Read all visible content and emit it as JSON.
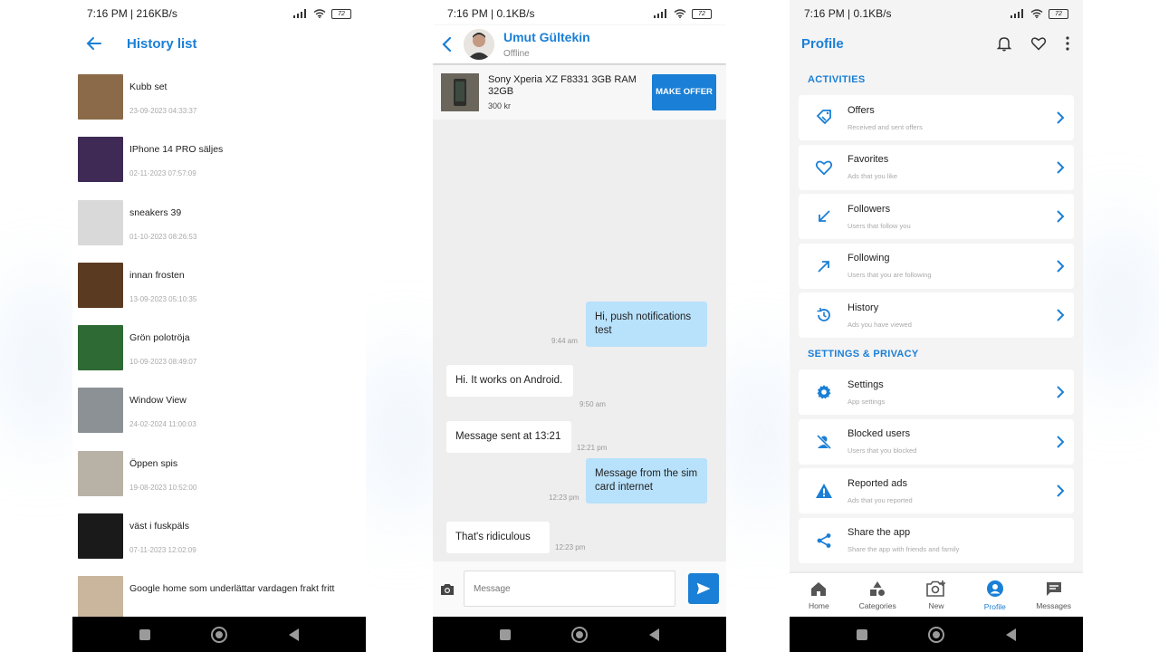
{
  "colors": {
    "accent": "#1a7fd6",
    "bubble_out": "#b8e1fb",
    "bubble_in": "#ffffff"
  },
  "phone1": {
    "status_text": "7:16 PM | 216KB/s",
    "battery": "72",
    "title": "History list",
    "items": [
      {
        "name": "Kubb set",
        "date": "23-09-2023 04:33:37",
        "thumb_color": "#8a6a48"
      },
      {
        "name": "IPhone 14 PRO säljes",
        "date": "02-11-2023 07:57:09",
        "thumb_color": "#3e2a55"
      },
      {
        "name": "sneakers 39",
        "date": "01-10-2023 08:26:53",
        "thumb_color": "#d9d9d9"
      },
      {
        "name": "innan frosten",
        "date": "13-09-2023 05:10:35",
        "thumb_color": "#5b3a22"
      },
      {
        "name": "Grön polotröja",
        "date": "10-09-2023 08:49:07",
        "thumb_color": "#2e6a33"
      },
      {
        "name": "Window View",
        "date": "24-02-2024 11:00:03",
        "thumb_color": "#8c9196"
      },
      {
        "name": "Öppen spis",
        "date": "19-08-2023 10:52:00",
        "thumb_color": "#b8b2a6"
      },
      {
        "name": "väst i fuskpäls",
        "date": "07-11-2023 12:02:09",
        "thumb_color": "#1a1a1a"
      },
      {
        "name": "Google home som underlättar vardagen frakt fritt",
        "date": "",
        "thumb_color": "#c9b69c"
      }
    ]
  },
  "phone2": {
    "status_text": "7:16 PM | 0.1KB/s",
    "battery": "72",
    "contact_name": "Umut Gültekin",
    "contact_status": "Offline",
    "offer": {
      "title": "Sony Xperia XZ F8331 3GB RAM 32GB",
      "price": "300 kr",
      "button": "MAKE OFFER"
    },
    "messages": [
      {
        "text": "Hi, push notifications test",
        "time": "9:44 am"
      },
      {
        "text": "Hi. It works on Android.",
        "time": "9:50 am"
      },
      {
        "text": "Message sent at 13:21",
        "time": "12:21 pm"
      },
      {
        "text": "Message from the sim card internet",
        "time": "12:23 pm"
      },
      {
        "text": "That's ridiculous",
        "time": "12:23 pm"
      }
    ],
    "input_placeholder": "Message"
  },
  "phone3": {
    "status_text": "7:16 PM | 0.1KB/s",
    "battery": "72",
    "title": "Profile",
    "activities_label": "ACTIVITIES",
    "settings_label": "SETTINGS & PRIVACY",
    "activities": [
      {
        "title": "Offers",
        "sub": "Received and sent offers",
        "icon": "offers-icon"
      },
      {
        "title": "Favorites",
        "sub": "Ads that you like",
        "icon": "heart-icon"
      },
      {
        "title": "Followers",
        "sub": "Users that follow you",
        "icon": "arrow-down-left-icon"
      },
      {
        "title": "Following",
        "sub": "Users that you are following",
        "icon": "arrow-up-right-icon"
      },
      {
        "title": "History",
        "sub": "Ads you have viewed",
        "icon": "history-icon"
      }
    ],
    "settings": [
      {
        "title": "Settings",
        "sub": "App settings",
        "icon": "gear-icon"
      },
      {
        "title": "Blocked users",
        "sub": "Users that you blocked",
        "icon": "blocked-user-icon"
      },
      {
        "title": "Reported ads",
        "sub": "Ads that you reported",
        "icon": "warning-icon"
      },
      {
        "title": "Share the app",
        "sub": "Share the app with friends and family",
        "icon": "share-icon"
      }
    ],
    "tabs": [
      {
        "label": "Home",
        "icon": "home-icon"
      },
      {
        "label": "Categories",
        "icon": "categories-icon"
      },
      {
        "label": "New",
        "icon": "new-photo-icon"
      },
      {
        "label": "Profile",
        "icon": "profile-icon"
      },
      {
        "label": "Messages",
        "icon": "messages-icon"
      }
    ]
  }
}
